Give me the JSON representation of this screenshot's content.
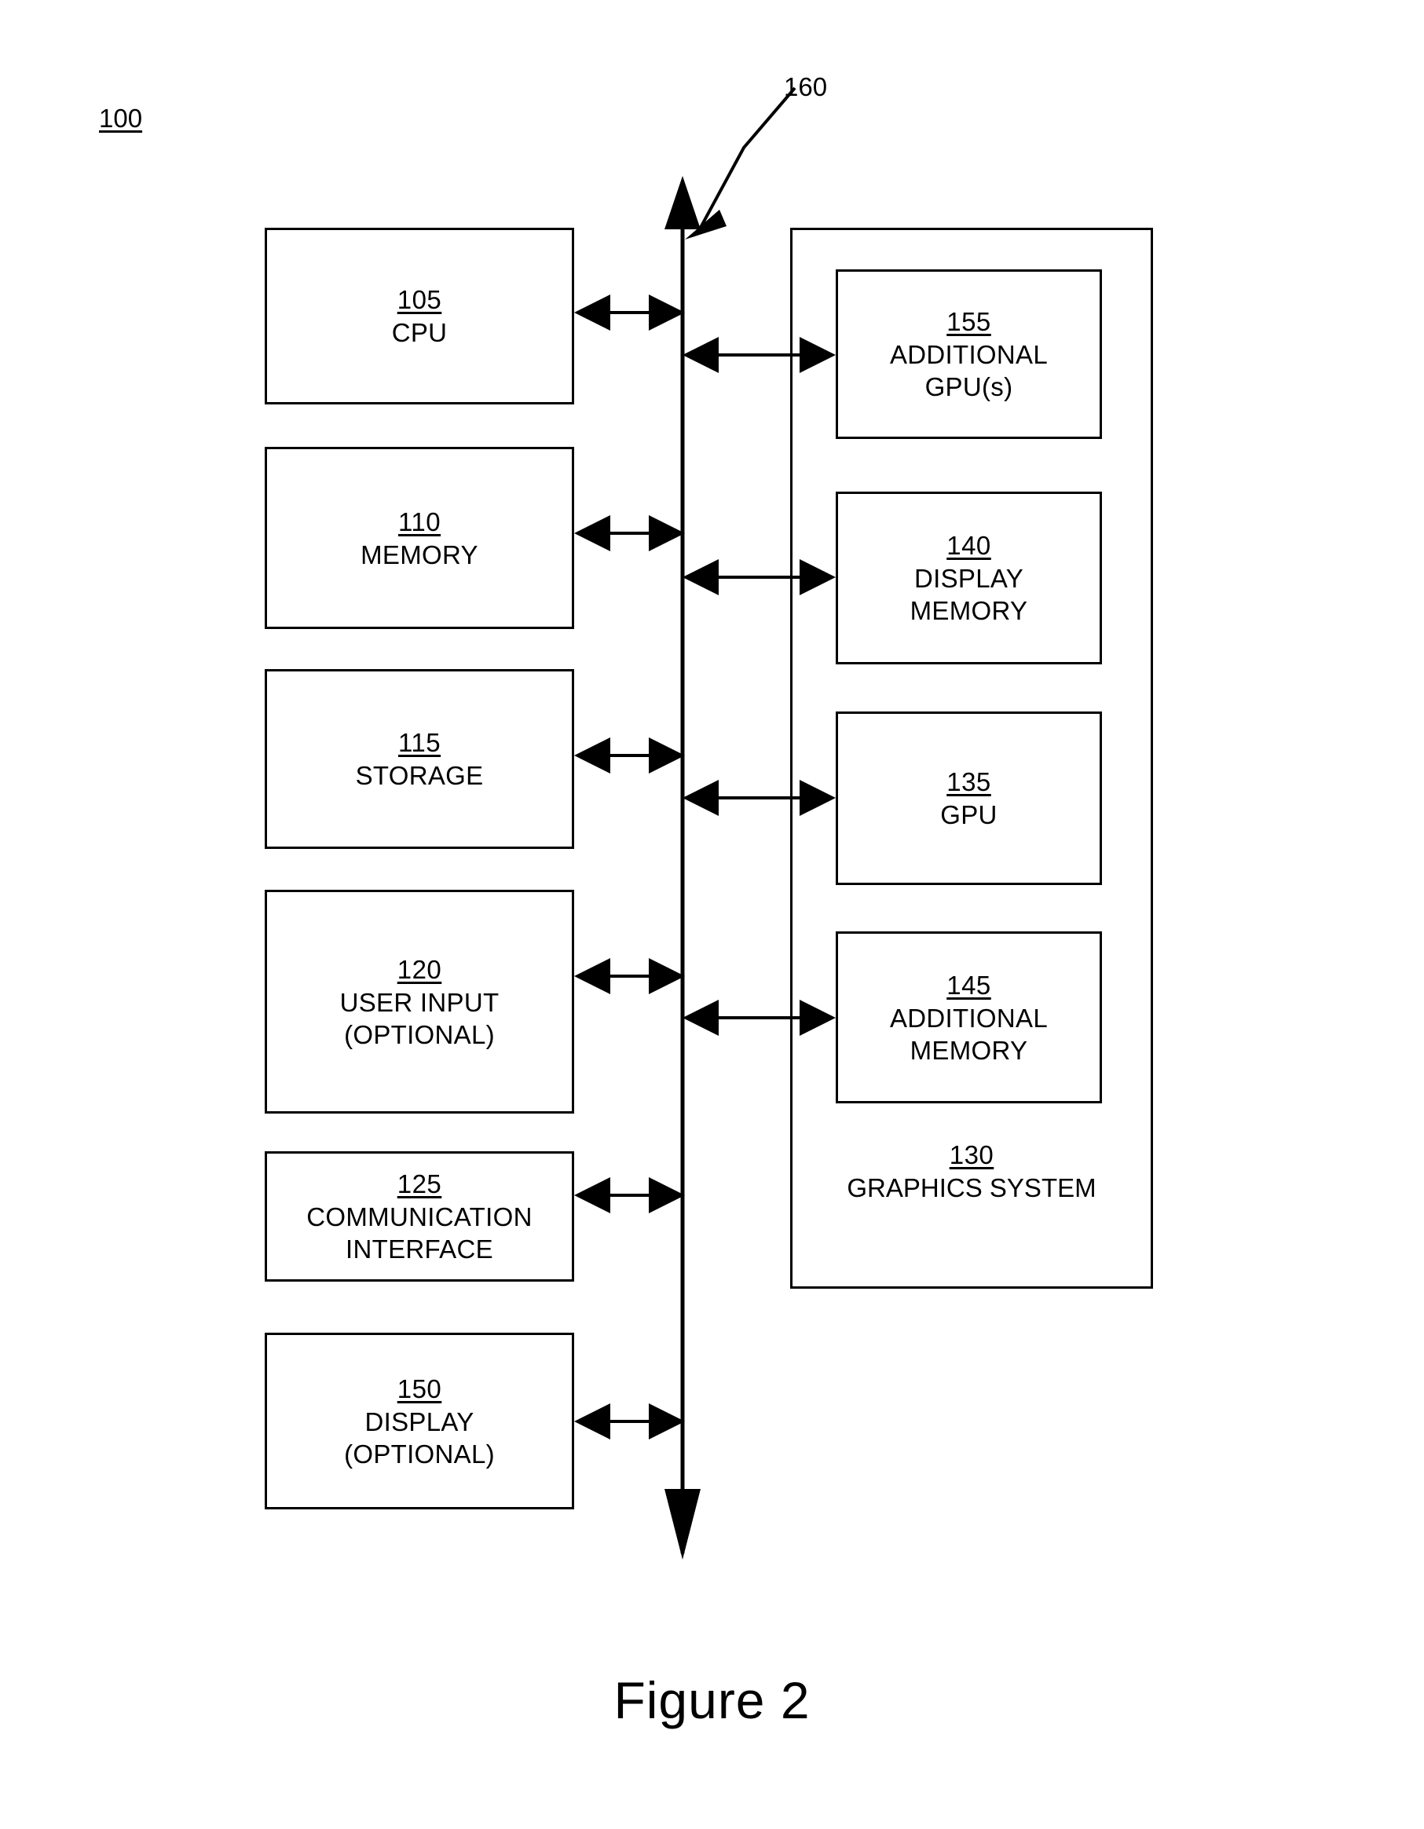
{
  "figure": {
    "caption": "Figure 2",
    "system_ref": "100",
    "bus_ref": "160"
  },
  "left_column": [
    {
      "ref": "105",
      "label": "CPU"
    },
    {
      "ref": "110",
      "label": "MEMORY"
    },
    {
      "ref": "115",
      "label": "STORAGE"
    },
    {
      "ref": "120",
      "label": "USER INPUT\n(OPTIONAL)"
    },
    {
      "ref": "125",
      "label": "COMMUNICATION\nINTERFACE"
    },
    {
      "ref": "150",
      "label": "DISPLAY\n(OPTIONAL)"
    }
  ],
  "graphics_system": {
    "ref": "130",
    "label": "GRAPHICS SYSTEM",
    "components": [
      {
        "ref": "155",
        "label": "ADDITIONAL\nGPU(s)"
      },
      {
        "ref": "140",
        "label": "DISPLAY\nMEMORY"
      },
      {
        "ref": "135",
        "label": "GPU"
      },
      {
        "ref": "145",
        "label": "ADDITIONAL\nMEMORY"
      }
    ]
  },
  "colors": {
    "stroke": "#000000",
    "background": "#ffffff"
  }
}
